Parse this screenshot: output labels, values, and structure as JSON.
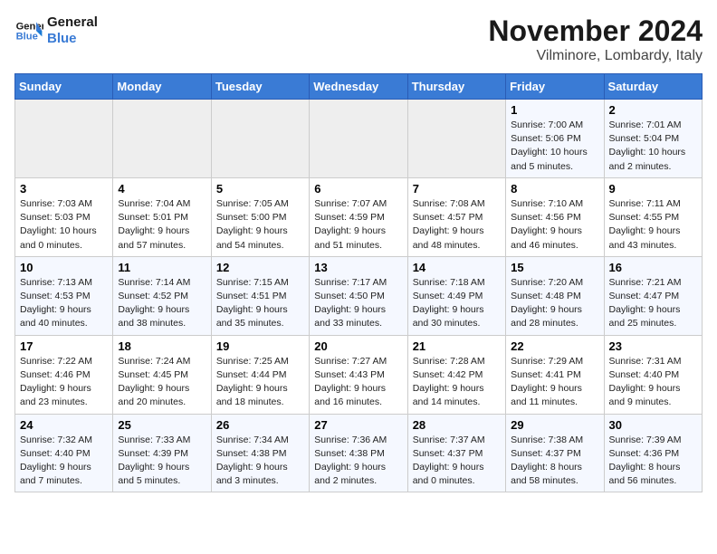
{
  "header": {
    "logo_line1": "General",
    "logo_line2": "Blue",
    "month": "November 2024",
    "location": "Vilminore, Lombardy, Italy"
  },
  "weekdays": [
    "Sunday",
    "Monday",
    "Tuesday",
    "Wednesday",
    "Thursday",
    "Friday",
    "Saturday"
  ],
  "rows": [
    [
      {
        "day": "",
        "info": ""
      },
      {
        "day": "",
        "info": ""
      },
      {
        "day": "",
        "info": ""
      },
      {
        "day": "",
        "info": ""
      },
      {
        "day": "",
        "info": ""
      },
      {
        "day": "1",
        "info": "Sunrise: 7:00 AM\nSunset: 5:06 PM\nDaylight: 10 hours\nand 5 minutes."
      },
      {
        "day": "2",
        "info": "Sunrise: 7:01 AM\nSunset: 5:04 PM\nDaylight: 10 hours\nand 2 minutes."
      }
    ],
    [
      {
        "day": "3",
        "info": "Sunrise: 7:03 AM\nSunset: 5:03 PM\nDaylight: 10 hours\nand 0 minutes."
      },
      {
        "day": "4",
        "info": "Sunrise: 7:04 AM\nSunset: 5:01 PM\nDaylight: 9 hours\nand 57 minutes."
      },
      {
        "day": "5",
        "info": "Sunrise: 7:05 AM\nSunset: 5:00 PM\nDaylight: 9 hours\nand 54 minutes."
      },
      {
        "day": "6",
        "info": "Sunrise: 7:07 AM\nSunset: 4:59 PM\nDaylight: 9 hours\nand 51 minutes."
      },
      {
        "day": "7",
        "info": "Sunrise: 7:08 AM\nSunset: 4:57 PM\nDaylight: 9 hours\nand 48 minutes."
      },
      {
        "day": "8",
        "info": "Sunrise: 7:10 AM\nSunset: 4:56 PM\nDaylight: 9 hours\nand 46 minutes."
      },
      {
        "day": "9",
        "info": "Sunrise: 7:11 AM\nSunset: 4:55 PM\nDaylight: 9 hours\nand 43 minutes."
      }
    ],
    [
      {
        "day": "10",
        "info": "Sunrise: 7:13 AM\nSunset: 4:53 PM\nDaylight: 9 hours\nand 40 minutes."
      },
      {
        "day": "11",
        "info": "Sunrise: 7:14 AM\nSunset: 4:52 PM\nDaylight: 9 hours\nand 38 minutes."
      },
      {
        "day": "12",
        "info": "Sunrise: 7:15 AM\nSunset: 4:51 PM\nDaylight: 9 hours\nand 35 minutes."
      },
      {
        "day": "13",
        "info": "Sunrise: 7:17 AM\nSunset: 4:50 PM\nDaylight: 9 hours\nand 33 minutes."
      },
      {
        "day": "14",
        "info": "Sunrise: 7:18 AM\nSunset: 4:49 PM\nDaylight: 9 hours\nand 30 minutes."
      },
      {
        "day": "15",
        "info": "Sunrise: 7:20 AM\nSunset: 4:48 PM\nDaylight: 9 hours\nand 28 minutes."
      },
      {
        "day": "16",
        "info": "Sunrise: 7:21 AM\nSunset: 4:47 PM\nDaylight: 9 hours\nand 25 minutes."
      }
    ],
    [
      {
        "day": "17",
        "info": "Sunrise: 7:22 AM\nSunset: 4:46 PM\nDaylight: 9 hours\nand 23 minutes."
      },
      {
        "day": "18",
        "info": "Sunrise: 7:24 AM\nSunset: 4:45 PM\nDaylight: 9 hours\nand 20 minutes."
      },
      {
        "day": "19",
        "info": "Sunrise: 7:25 AM\nSunset: 4:44 PM\nDaylight: 9 hours\nand 18 minutes."
      },
      {
        "day": "20",
        "info": "Sunrise: 7:27 AM\nSunset: 4:43 PM\nDaylight: 9 hours\nand 16 minutes."
      },
      {
        "day": "21",
        "info": "Sunrise: 7:28 AM\nSunset: 4:42 PM\nDaylight: 9 hours\nand 14 minutes."
      },
      {
        "day": "22",
        "info": "Sunrise: 7:29 AM\nSunset: 4:41 PM\nDaylight: 9 hours\nand 11 minutes."
      },
      {
        "day": "23",
        "info": "Sunrise: 7:31 AM\nSunset: 4:40 PM\nDaylight: 9 hours\nand 9 minutes."
      }
    ],
    [
      {
        "day": "24",
        "info": "Sunrise: 7:32 AM\nSunset: 4:40 PM\nDaylight: 9 hours\nand 7 minutes."
      },
      {
        "day": "25",
        "info": "Sunrise: 7:33 AM\nSunset: 4:39 PM\nDaylight: 9 hours\nand 5 minutes."
      },
      {
        "day": "26",
        "info": "Sunrise: 7:34 AM\nSunset: 4:38 PM\nDaylight: 9 hours\nand 3 minutes."
      },
      {
        "day": "27",
        "info": "Sunrise: 7:36 AM\nSunset: 4:38 PM\nDaylight: 9 hours\nand 2 minutes."
      },
      {
        "day": "28",
        "info": "Sunrise: 7:37 AM\nSunset: 4:37 PM\nDaylight: 9 hours\nand 0 minutes."
      },
      {
        "day": "29",
        "info": "Sunrise: 7:38 AM\nSunset: 4:37 PM\nDaylight: 8 hours\nand 58 minutes."
      },
      {
        "day": "30",
        "info": "Sunrise: 7:39 AM\nSunset: 4:36 PM\nDaylight: 8 hours\nand 56 minutes."
      }
    ]
  ]
}
